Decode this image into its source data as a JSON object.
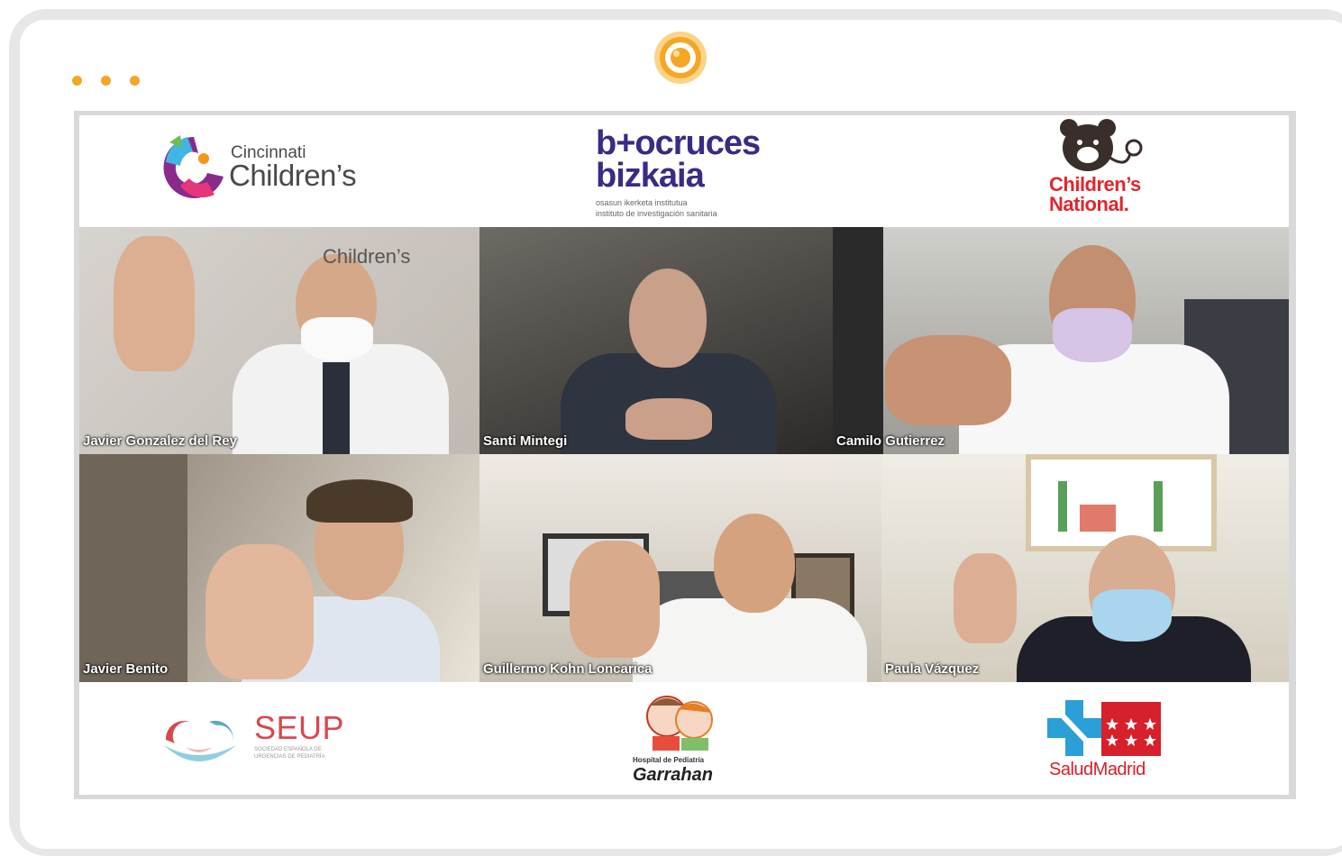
{
  "device": {
    "accent": "#f5a623",
    "menu_icon": "dots-menu-icon",
    "camera_icon": "camera-icon"
  },
  "logos_top": {
    "cincinnati": {
      "line1": "Cincinnati",
      "line2": "Children’s",
      "icon": "cincinnati-childrens-icon"
    },
    "biocruces": {
      "line1": "b+ocruces",
      "line2": "bizkaia",
      "sub1": "osasun ikerketa institutua",
      "sub2": "instituto de investigación sanitaria"
    },
    "childrens_national": {
      "line1": "Children’s",
      "line2": "National.",
      "icon": "teddy-bear-icon"
    }
  },
  "participants": [
    {
      "name": "Javier Gonzalez del Rey"
    },
    {
      "name": "Santi Mintegi"
    },
    {
      "name": "Camilo Gutierrez"
    },
    {
      "name": "Javier Benito"
    },
    {
      "name": "Guillermo Kohn Loncarica"
    },
    {
      "name": "Paula Vázquez"
    }
  ],
  "logos_bottom": {
    "seup": {
      "title": "SEUP",
      "sub1": "SOCIEDAD ESPAÑOLA DE",
      "sub2": "URGENCIAS DE PEDIATRÍA"
    },
    "garrahan": {
      "line1": "Hospital de Pediatría",
      "line2": "Garrahan"
    },
    "salud_madrid": {
      "text": "SaludMadrid"
    }
  }
}
